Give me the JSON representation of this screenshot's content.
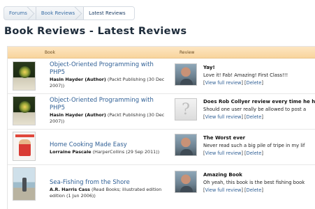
{
  "breadcrumb": {
    "items": [
      "Forums",
      "Book Reviews",
      "Latest Reviews"
    ]
  },
  "page": {
    "title": "Book Reviews - Latest Reviews"
  },
  "table": {
    "headers": {
      "book": "Book",
      "review": "Review"
    },
    "rows": [
      {
        "book_title_line1": "Object-Oriented Programming with",
        "book_title_line2": "PHP5",
        "author": "Hasin Hayder (Author)",
        "publisher": "(Packt Publishing (30 Dec",
        "publisher2": "2007))",
        "review_title": "Yay!",
        "review_text": "Love it! Fab! Amazing! First Class!!!",
        "view_label": "View full review",
        "delete_label": "Delete"
      },
      {
        "book_title_line1": "Object-Oriented Programming with",
        "book_title_line2": "PHP5",
        "author": "Hasin Hayder (Author)",
        "publisher": "(Packt Publishing (30 Dec",
        "publisher2": "2007))",
        "review_title": "Does Rob Collyer review every time he ha",
        "review_text": "Should one user really be allowed to post a",
        "view_label": "View full review",
        "delete_label": "Delete"
      },
      {
        "book_title_line1": "Home Cooking Made Easy",
        "author": "Lorraine Pascale",
        "publisher": "(HarperCollins (29 Sep 2011))",
        "review_title": "The Worst ever",
        "review_text": "Never read such a big pile of tripe in my lif",
        "view_label": "View full review",
        "delete_label": "Delete"
      },
      {
        "book_title_line1": "Sea-Fishing from the Shore",
        "author": "A.R. Harris Cass",
        "publisher": "(Read Books; illustrated edition",
        "publisher2": "edition (1 Jun 2006))",
        "review_title": "Amazing Book",
        "review_text": "Oh yeah, this book is the best fishing book",
        "view_label": "View full review",
        "delete_label": "Delete"
      }
    ]
  }
}
